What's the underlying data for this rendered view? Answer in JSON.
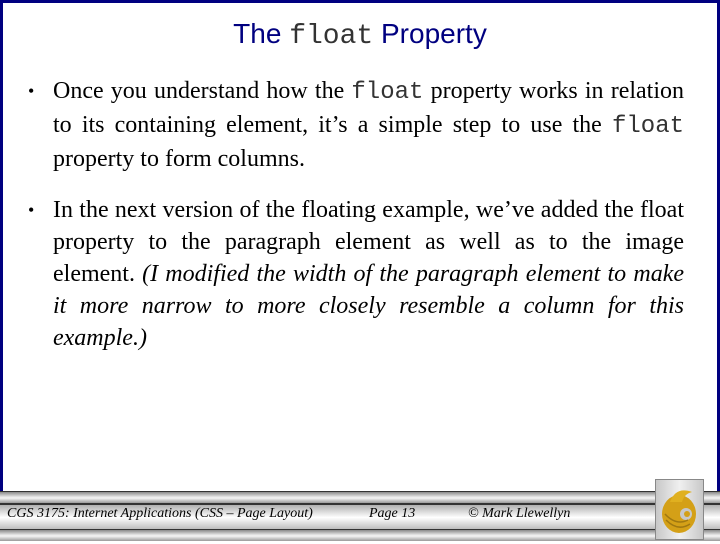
{
  "slide": {
    "title": {
      "prefix": "The ",
      "code": "float",
      "suffix": " Property"
    },
    "bullets": [
      {
        "symbol": "•",
        "parts": [
          {
            "text": "Once you understand how the ",
            "style": "normal"
          },
          {
            "text": "float",
            "style": "code"
          },
          {
            "text": " property works in relation to its containing element, it’s a simple step to use the ",
            "style": "normal"
          },
          {
            "text": "float",
            "style": "code"
          },
          {
            "text": " property to form columns.",
            "style": "normal"
          }
        ]
      },
      {
        "symbol": "•",
        "parts": [
          {
            "text": "In the next version of the floating example, we’ve added the float property to the paragraph element as well as to the image element.  ",
            "style": "normal"
          },
          {
            "text": "(I modified the width of the paragraph element to make it more narrow to more closely resemble a column for this example.)",
            "style": "italic"
          }
        ]
      }
    ]
  },
  "footer": {
    "course": "CGS 3175: Internet Applications (CSS – Page Layout)",
    "page": "Page 13",
    "author": "© Mark Llewellyn",
    "logo_icon": "pegasus-logo-icon"
  },
  "colors": {
    "title": "#000080",
    "border": "#000080",
    "logo_gold": "#d4a017"
  }
}
